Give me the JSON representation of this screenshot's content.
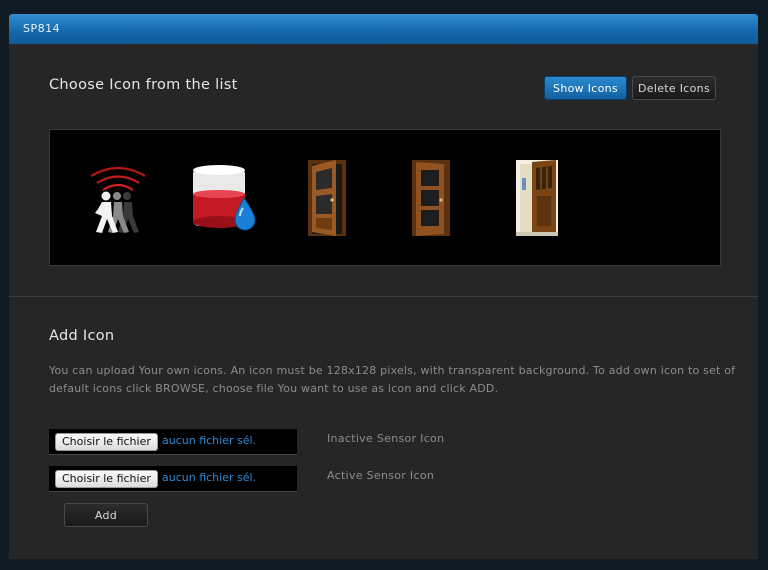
{
  "window": {
    "title": "SP814"
  },
  "choose": {
    "heading": "Choose Icon from the list",
    "show_label": "Show Icons",
    "delete_label": "Delete Icons",
    "icons": [
      "motion-sensor-icon",
      "water-leak-sensor-icon",
      "door-open-icon",
      "door-closed-icon",
      "front-door-icon"
    ]
  },
  "add": {
    "heading": "Add Icon",
    "description": "You can upload Your own icons. An icon must be 128x128 pixels, with transparent background. To add own icon to set of default icons click BROWSE, choose file You want to use as icon and click ADD.",
    "inactive": {
      "button": "Choisir le fichier",
      "status": "aucun fichier sél.",
      "label": "Inactive Sensor Icon"
    },
    "active": {
      "button": "Choisir le fichier",
      "status": "aucun fichier sél.",
      "label": "Active Sensor Icon"
    },
    "add_label": "Add"
  },
  "colors": {
    "accent": "#1b74b8",
    "panel": "#262626",
    "link": "#2e8ad8"
  }
}
